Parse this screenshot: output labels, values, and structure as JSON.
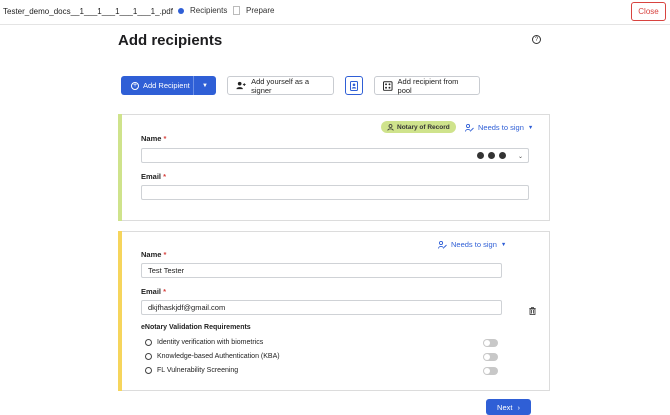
{
  "header": {
    "doc_title": "Tester_demo_docs__1___1___1___1___1_.pdf",
    "steps": [
      {
        "label": "Recipients",
        "active": true
      },
      {
        "label": "Prepare",
        "active": false
      }
    ],
    "close_label": "Close"
  },
  "page": {
    "title": "Add recipients"
  },
  "toolbar": {
    "add_recipient_label": "Add Recipient",
    "add_yourself_label": "Add yourself as a signer",
    "add_from_pool_label": "Add recipient from pool"
  },
  "recipient1": {
    "badge": "Notary of Record",
    "role": "Needs to sign",
    "name_label": "Name",
    "name_value": "",
    "email_label": "Email",
    "email_value": "",
    "accent_color": "#cfe38c"
  },
  "recipient2": {
    "role": "Needs to sign",
    "name_label": "Name",
    "name_value": "Test Tester",
    "email_label": "Email",
    "email_value": "dkjfhaskjdf@gmail.com",
    "accent_color": "#f6d55c",
    "requirements_title": "eNotary Validation Requirements",
    "requirements": [
      "Identity verification with biometrics",
      "Knowledge-based Authentication (KBA)",
      "FL Vulnerability Screening"
    ]
  },
  "footer": {
    "next_label": "Next"
  },
  "colors": {
    "primary": "#2f5fd6",
    "danger": "#d8433f"
  }
}
